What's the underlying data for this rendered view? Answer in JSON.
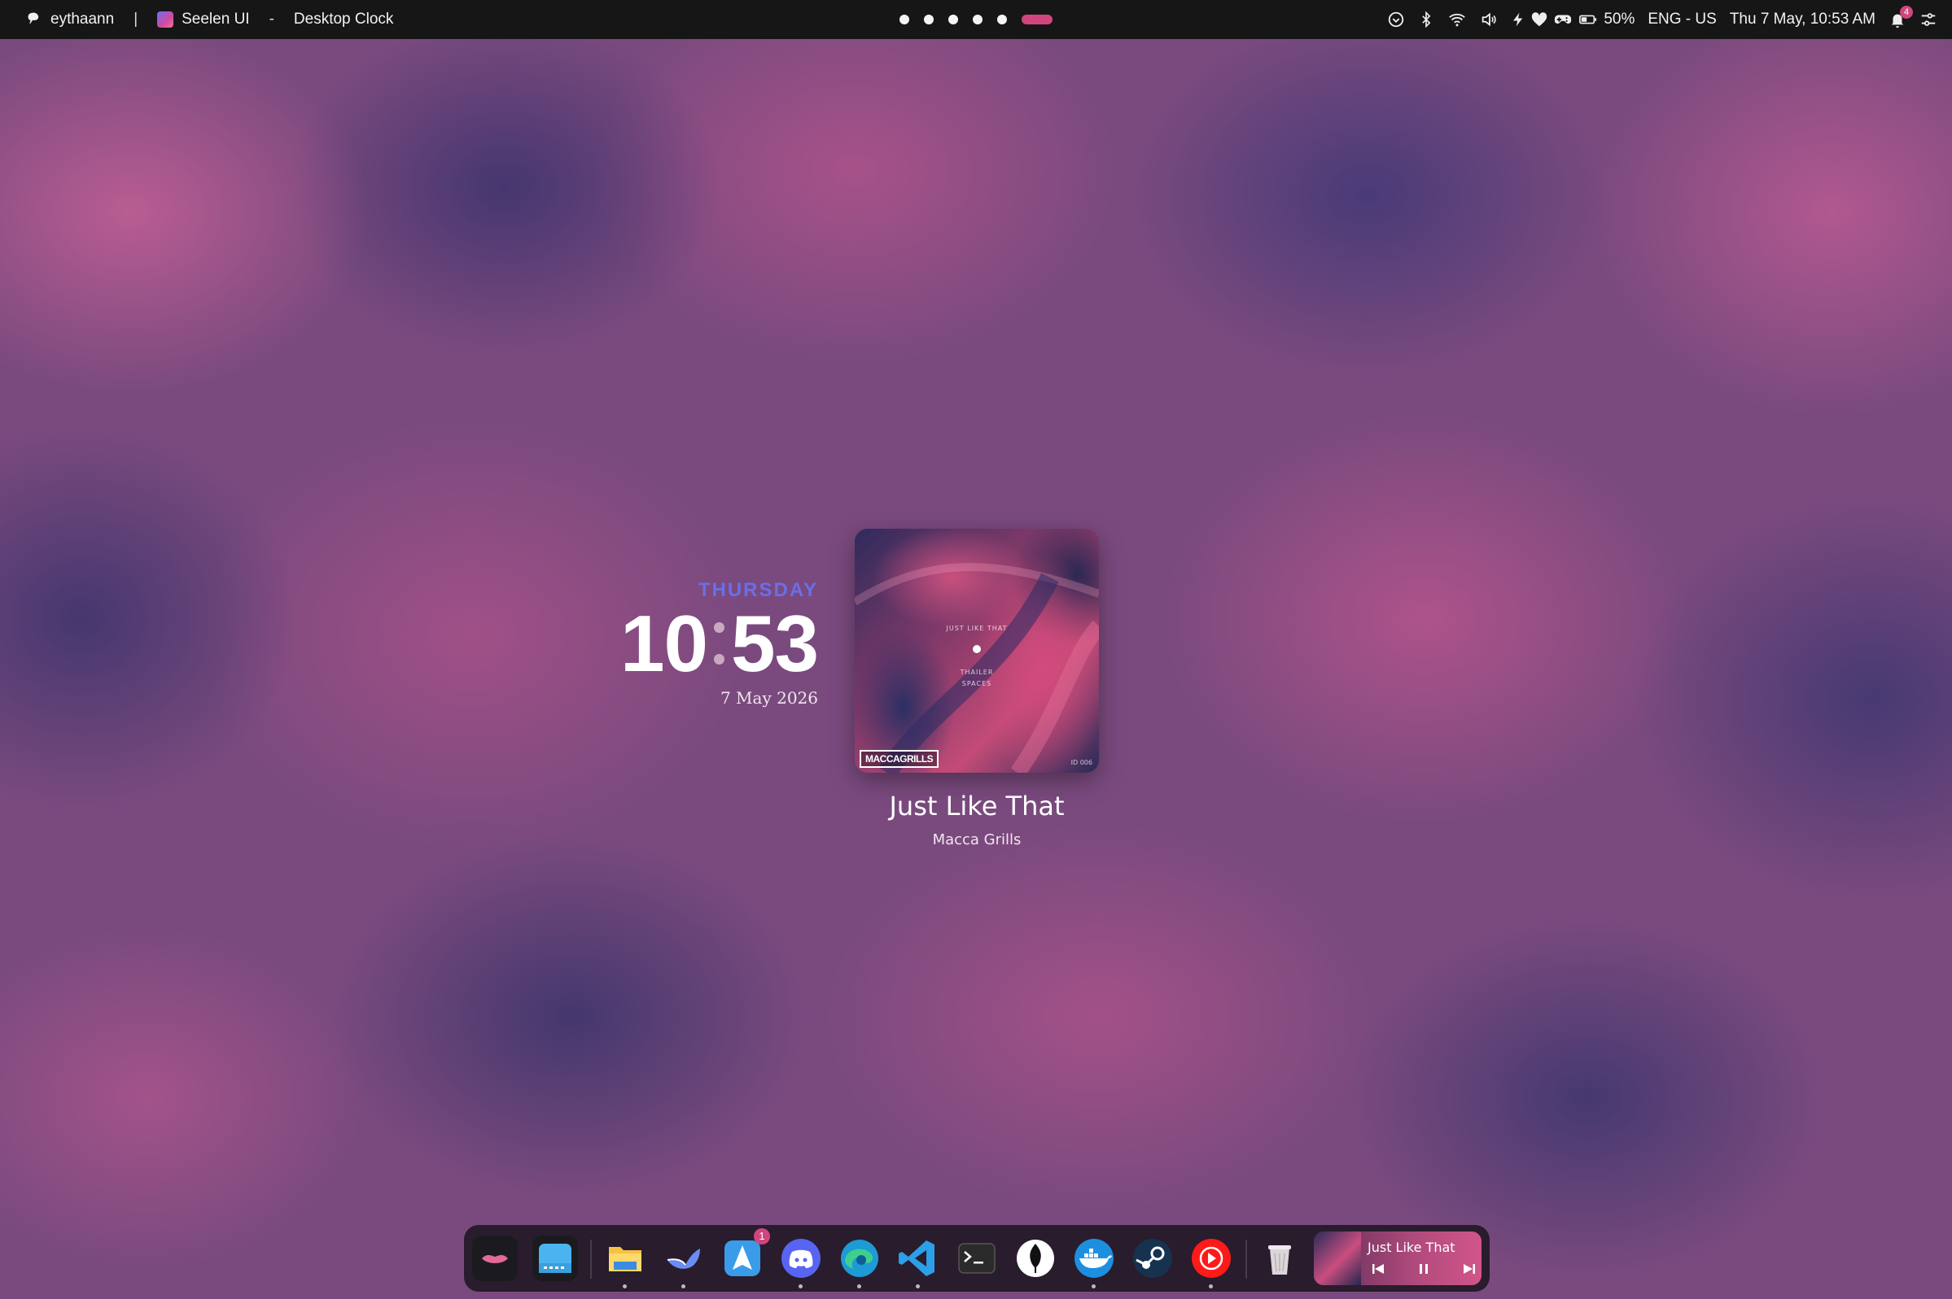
{
  "topbar": {
    "username": "eythaann",
    "separator": "|",
    "app_name": "Seelen UI",
    "dash": "-",
    "window_title": "Desktop Clock",
    "workspaces": {
      "count": 6,
      "active_index": 5,
      "active_color": "#d1457f"
    },
    "battery": "50%",
    "language": "ENG - US",
    "datetime": "Thu 7 May, 10:53 AM",
    "notification_count": "4",
    "icons": [
      "chevron-circle-icon",
      "bluetooth-icon",
      "wifi-icon",
      "volume-icon",
      "bolt-icon",
      "heart-icon",
      "gamepad-icon",
      "battery-icon",
      "bell-icon",
      "settings-sliders-icon"
    ]
  },
  "clock": {
    "day": "THURSDAY",
    "hours": "10",
    "minutes": "53",
    "date": "7 May 2026",
    "day_color": "#6b6ee8"
  },
  "media": {
    "title": "Just Like That",
    "artist": "Macca Grills",
    "cover_text_top": "JUST LIKE THAT",
    "cover_text_mid1": "THAILER",
    "cover_text_mid2": "SPACES",
    "cover_logo": "MACCAGRILLS",
    "cover_code": "ID 006"
  },
  "dock": {
    "items": [
      {
        "name": "seelen-lips-icon",
        "running": false
      },
      {
        "name": "window-manager-icon",
        "running": false
      },
      {
        "name": "file-explorer-icon",
        "running": true
      },
      {
        "name": "bird-app-icon",
        "running": true
      },
      {
        "name": "send-app-icon",
        "running": false,
        "badge": "1"
      },
      {
        "name": "discord-icon",
        "running": true
      },
      {
        "name": "edge-icon",
        "running": true
      },
      {
        "name": "vscode-icon",
        "running": true
      },
      {
        "name": "terminal-icon",
        "running": false
      },
      {
        "name": "mongodb-icon",
        "running": false
      },
      {
        "name": "docker-icon",
        "running": true
      },
      {
        "name": "steam-icon",
        "running": false
      },
      {
        "name": "youtube-music-icon",
        "running": true
      },
      {
        "name": "trash-icon",
        "running": false
      }
    ],
    "media_title": "Just Like That"
  }
}
